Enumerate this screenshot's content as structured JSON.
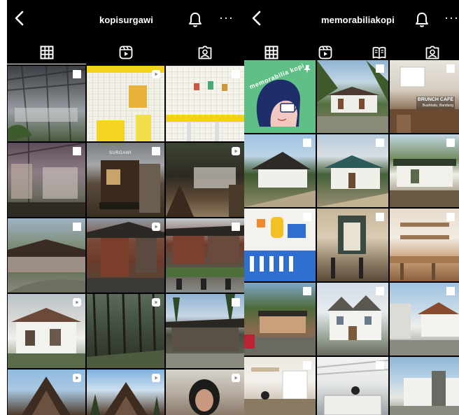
{
  "panels": [
    {
      "id": "left",
      "username": "kopisurgawi"
    },
    {
      "id": "right",
      "username": "memorabiliakopi"
    }
  ],
  "icons": {
    "back": "chevron-left-icon",
    "bell": "bell-icon",
    "more": "more-horizontal-icon",
    "more_glyph": "···",
    "grid": "grid-icon",
    "reels": "reels-icon",
    "guides": "guides-icon",
    "tagged": "tagged-icon",
    "multi": "multiple-posts-icon",
    "video": "reel-badge-icon",
    "pin": "pin-icon"
  },
  "memo_post": {
    "title": "memorabilia kopi"
  },
  "brunch_post": {
    "title": "BRUNCH CAFE",
    "subtitle": "Buahbatu, Bandung"
  },
  "sign_post": {
    "text": "SURGAWI"
  }
}
